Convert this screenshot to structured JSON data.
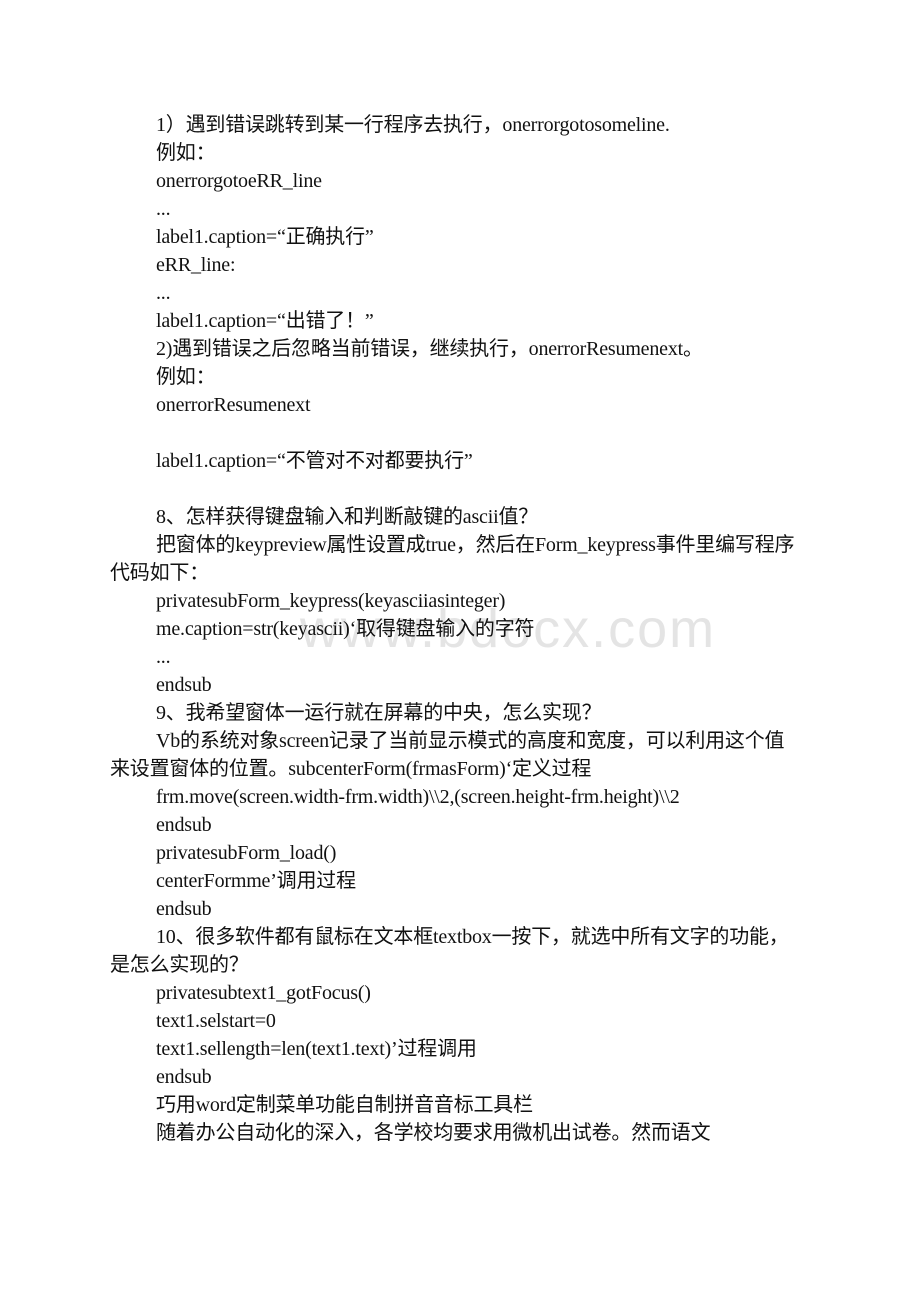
{
  "watermark": "www.bdocx.com",
  "section1": {
    "lines": [
      "1）遇到错误跳转到某一行程序去执行，onerrorgotosomeline.",
      "例如：",
      "onerrorgotoeRR_line",
      "...",
      "label1.caption=“正确执行”",
      "eRR_line:",
      "...",
      "label1.caption=“出错了！”",
      "2)遇到错误之后忽略当前错误，继续执行，onerrorResumenext。",
      "例如：",
      "onerrorResumenext",
      "label1.caption=“不管对不对都要执行”"
    ]
  },
  "q8": {
    "title": "8、怎样获得键盘输入和判断敲键的ascii值？",
    "para": "把窗体的keypreview属性设置成true，然后在Form_keypress事件里编写程序代码如下：",
    "code": [
      "privatesubForm_keypress(keyasciiasinteger)",
      "me.caption=str(keyascii)‘取得键盘输入的字符",
      "...",
      "endsub"
    ]
  },
  "q9": {
    "title": "9、我希望窗体一运行就在屏幕的中央，怎么实现？",
    "para": "Vb的系统对象screen记录了当前显示模式的高度和宽度，可以利用这个值来设置窗体的位置。subcenterForm(frmasForm)‘定义过程",
    "code": [
      "frm.move(screen.width-frm.width)\\\\2,(screen.height-frm.height)\\\\2",
      "endsub",
      "privatesubForm_load()",
      "centerFormme’调用过程",
      "endsub"
    ]
  },
  "q10": {
    "title": "10、很多软件都有鼠标在文本框textbox一按下，就选中所有文字的功能，是怎么实现的？",
    "code": [
      "privatesubtext1_gotFocus()",
      "text1.selstart=0",
      "text1.sellength=len(text1.text)’过程调用",
      "endsub"
    ]
  },
  "article": {
    "title": "巧用word定制菜单功能自制拼音音标工具栏",
    "first_line": "随着办公自动化的深入，各学校均要求用微机出试卷。然而语文"
  }
}
